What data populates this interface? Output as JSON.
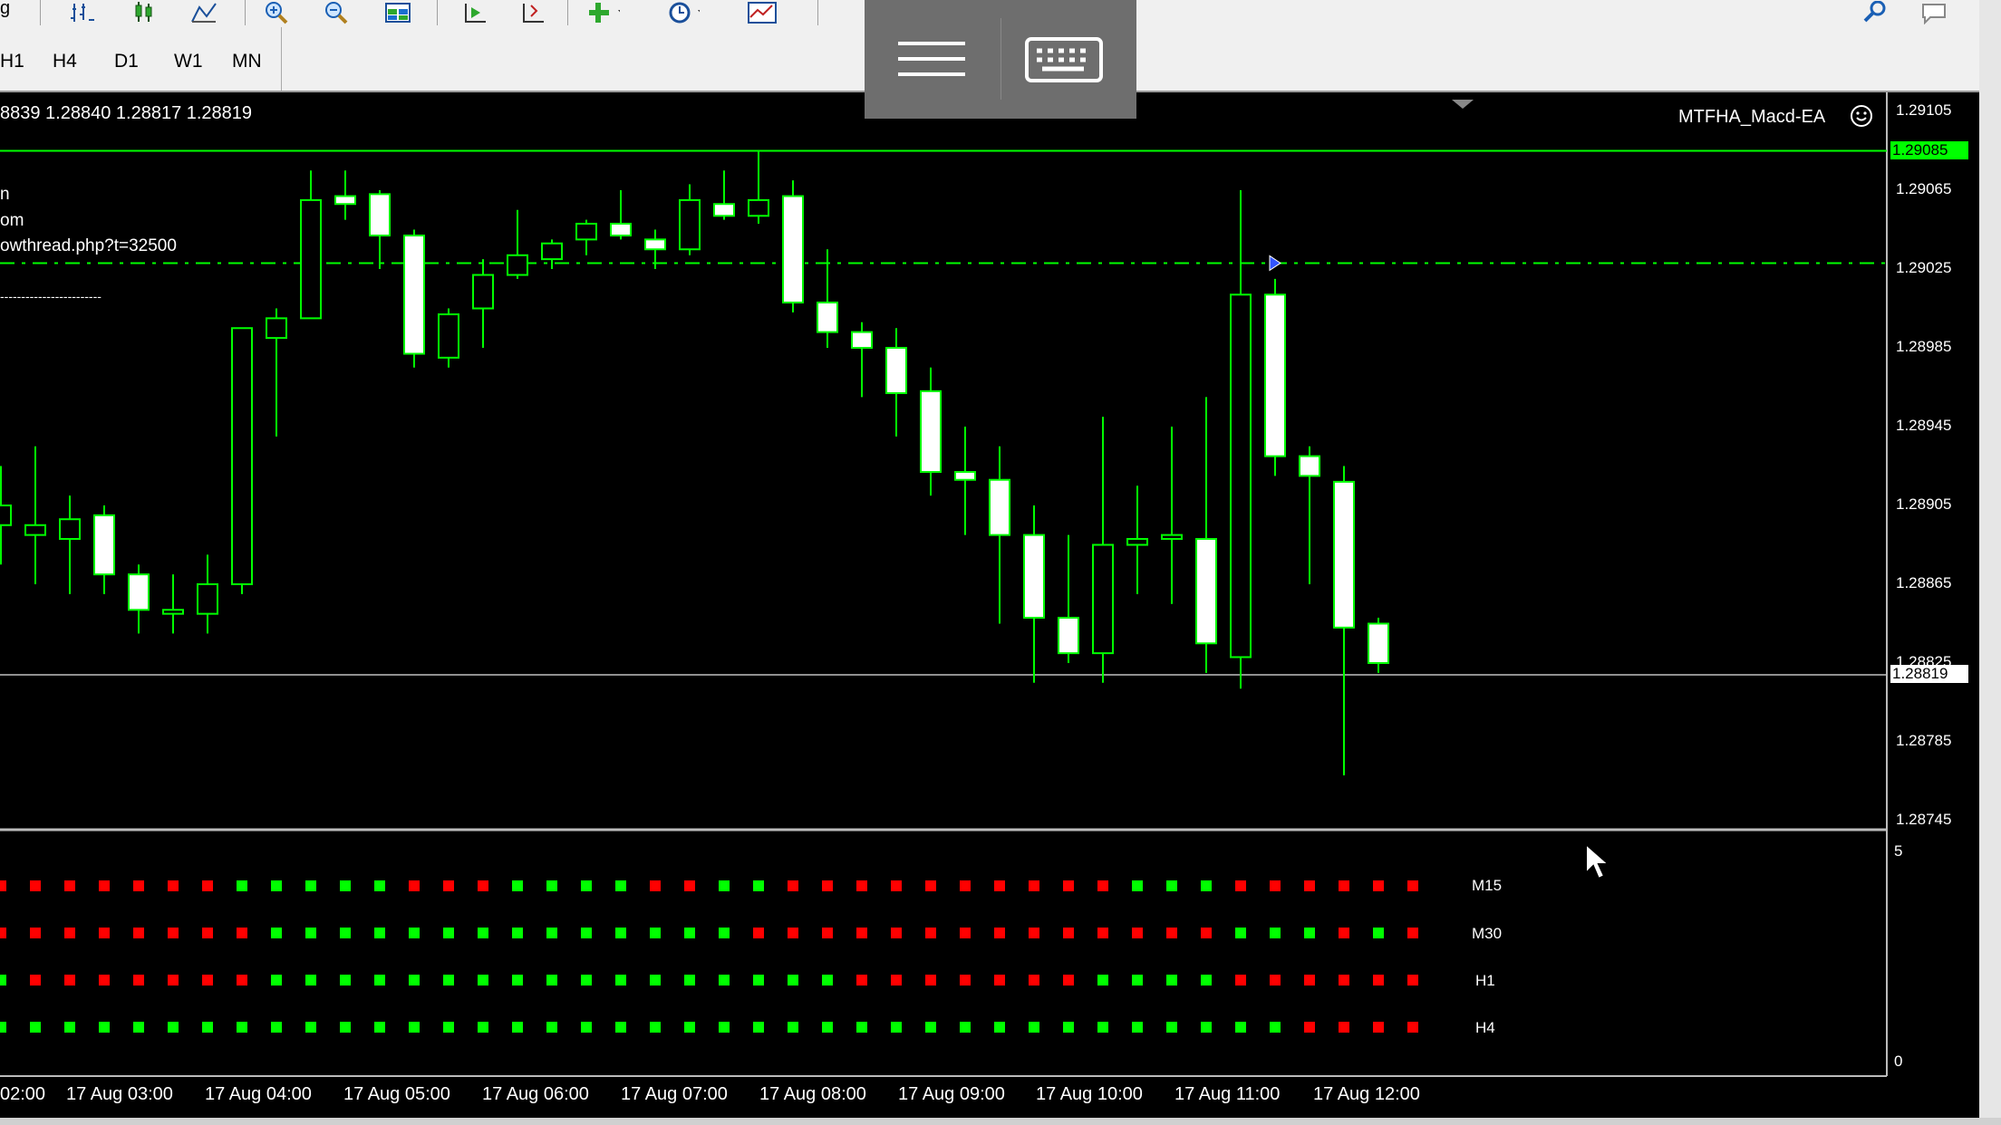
{
  "toolbar": {
    "left_fragment": "g",
    "buttons": [
      "crosshair-bars-icon",
      "candles-icon",
      "line-chart-icon",
      "zoom-in-icon",
      "zoom-out-icon",
      "tile-windows-icon",
      "autoscroll-icon",
      "chart-shift-icon",
      "indicators-icon",
      "periods-icon",
      "templates-icon"
    ]
  },
  "timeframes": [
    "H1",
    "H4",
    "D1",
    "W1",
    "MN"
  ],
  "colors": {
    "bull": "#00ff00",
    "bear_wick": "#00ff00",
    "bull_fill": "#000000",
    "bear_fill": "#ffffff",
    "grid_level": "#00ff00",
    "dot_green": "#00ff00",
    "dot_red": "#ff0000"
  },
  "chart": {
    "ohlc_text": "8839 1.28840 1.28817 1.28819",
    "ea_name": "MTFHA_Macd-EA",
    "info_lines": [
      "n",
      "om",
      "owthread.php?t=32500",
      "",
      "------------------------"
    ],
    "price_labels": [
      "1.29105",
      "1.29085",
      "1.29065",
      "1.29025",
      "1.28985",
      "1.28945",
      "1.28905",
      "1.28865",
      "1.28825",
      "1.28819",
      "1.28785",
      "1.28745"
    ],
    "highlight_price": "1.29085",
    "current_price": "1.28819",
    "time_labels": [
      "02:00",
      "17 Aug 03:00",
      "17 Aug 04:00",
      "17 Aug 05:00",
      "17 Aug 06:00",
      "17 Aug 07:00",
      "17 Aug 08:00",
      "17 Aug 09:00",
      "17 Aug 10:00",
      "17 Aug 11:00",
      "17 Aug 12:00"
    ]
  },
  "indicator": {
    "scale_max": "5",
    "scale_min": "0",
    "rows": [
      {
        "label": "M15",
        "dots": "RRRRRRRGGGGGRRRGGGGRRGGRRRRRRRRRRGGGRRRRRR"
      },
      {
        "label": "M30",
        "dots": "RRRRRRRRGGGGGGGGGGGGGGRRRRRRRRRRRRRRGGGRGR"
      },
      {
        "label": "H1",
        "dots": "GRRRRRRRGGGGGGGGGGGGGGGGGRRRRRRRGGGGRRRRRR"
      },
      {
        "label": "H4",
        "dots": "GGGGGGGGGGGGGGGGGGGGGGGGGGGGGGGGGGGGGGRRRR"
      }
    ]
  },
  "chart_data": {
    "type": "candlestick",
    "title": "",
    "ylim": [
      1.28725,
      1.29115
    ],
    "candles": [
      {
        "o": 1.28895,
        "h": 1.28925,
        "l": 1.28875,
        "c": 1.28905
      },
      {
        "o": 1.2889,
        "h": 1.28935,
        "l": 1.28865,
        "c": 1.28895
      },
      {
        "o": 1.28888,
        "h": 1.2891,
        "l": 1.2886,
        "c": 1.28898
      },
      {
        "o": 1.289,
        "h": 1.28905,
        "l": 1.2886,
        "c": 1.2887
      },
      {
        "o": 1.2887,
        "h": 1.28875,
        "l": 1.2884,
        "c": 1.28852
      },
      {
        "o": 1.2885,
        "h": 1.2887,
        "l": 1.2884,
        "c": 1.28852
      },
      {
        "o": 1.2885,
        "h": 1.2888,
        "l": 1.2884,
        "c": 1.28865
      },
      {
        "o": 1.28865,
        "h": 1.28985,
        "l": 1.2886,
        "c": 1.28995
      },
      {
        "o": 1.2899,
        "h": 1.29005,
        "l": 1.2894,
        "c": 1.29
      },
      {
        "o": 1.29,
        "h": 1.29075,
        "l": 1.29,
        "c": 1.2906
      },
      {
        "o": 1.29062,
        "h": 1.29075,
        "l": 1.2905,
        "c": 1.29058
      },
      {
        "o": 1.29063,
        "h": 1.29065,
        "l": 1.29025,
        "c": 1.29042
      },
      {
        "o": 1.29042,
        "h": 1.29045,
        "l": 1.28975,
        "c": 1.28982
      },
      {
        "o": 1.2898,
        "h": 1.29005,
        "l": 1.28975,
        "c": 1.29002
      },
      {
        "o": 1.29005,
        "h": 1.2903,
        "l": 1.28985,
        "c": 1.29022
      },
      {
        "o": 1.29022,
        "h": 1.29055,
        "l": 1.2902,
        "c": 1.29032
      },
      {
        "o": 1.2903,
        "h": 1.2904,
        "l": 1.29025,
        "c": 1.29038
      },
      {
        "o": 1.2904,
        "h": 1.2905,
        "l": 1.29032,
        "c": 1.29048
      },
      {
        "o": 1.29048,
        "h": 1.29065,
        "l": 1.2904,
        "c": 1.29042
      },
      {
        "o": 1.2904,
        "h": 1.29045,
        "l": 1.29025,
        "c": 1.29035
      },
      {
        "o": 1.29035,
        "h": 1.29068,
        "l": 1.29032,
        "c": 1.2906
      },
      {
        "o": 1.29058,
        "h": 1.29075,
        "l": 1.2905,
        "c": 1.29052
      },
      {
        "o": 1.29052,
        "h": 1.29085,
        "l": 1.29048,
        "c": 1.2906
      },
      {
        "o": 1.29062,
        "h": 1.2907,
        "l": 1.29003,
        "c": 1.29008
      },
      {
        "o": 1.29008,
        "h": 1.29035,
        "l": 1.28985,
        "c": 1.28993
      },
      {
        "o": 1.28993,
        "h": 1.28998,
        "l": 1.2896,
        "c": 1.28985
      },
      {
        "o": 1.28985,
        "h": 1.28995,
        "l": 1.2894,
        "c": 1.28962
      },
      {
        "o": 1.28963,
        "h": 1.28975,
        "l": 1.2891,
        "c": 1.28922
      },
      {
        "o": 1.28922,
        "h": 1.28945,
        "l": 1.2889,
        "c": 1.28918
      },
      {
        "o": 1.28918,
        "h": 1.28935,
        "l": 1.28845,
        "c": 1.2889
      },
      {
        "o": 1.2889,
        "h": 1.28905,
        "l": 1.28815,
        "c": 1.28848
      },
      {
        "o": 1.28848,
        "h": 1.2889,
        "l": 1.28825,
        "c": 1.2883
      },
      {
        "o": 1.2883,
        "h": 1.2895,
        "l": 1.28815,
        "c": 1.28885
      },
      {
        "o": 1.28885,
        "h": 1.28915,
        "l": 1.2886,
        "c": 1.28888
      },
      {
        "o": 1.28888,
        "h": 1.28945,
        "l": 1.28855,
        "c": 1.2889
      },
      {
        "o": 1.28888,
        "h": 1.2896,
        "l": 1.2882,
        "c": 1.28835
      },
      {
        "o": 1.28828,
        "h": 1.29065,
        "l": 1.28812,
        "c": 1.29012
      },
      {
        "o": 1.29012,
        "h": 1.2902,
        "l": 1.2892,
        "c": 1.2893
      },
      {
        "o": 1.2893,
        "h": 1.28935,
        "l": 1.28865,
        "c": 1.2892
      },
      {
        "o": 1.28917,
        "h": 1.28925,
        "l": 1.28768,
        "c": 1.28843
      },
      {
        "o": 1.28845,
        "h": 1.28848,
        "l": 1.2882,
        "c": 1.28825
      }
    ]
  }
}
